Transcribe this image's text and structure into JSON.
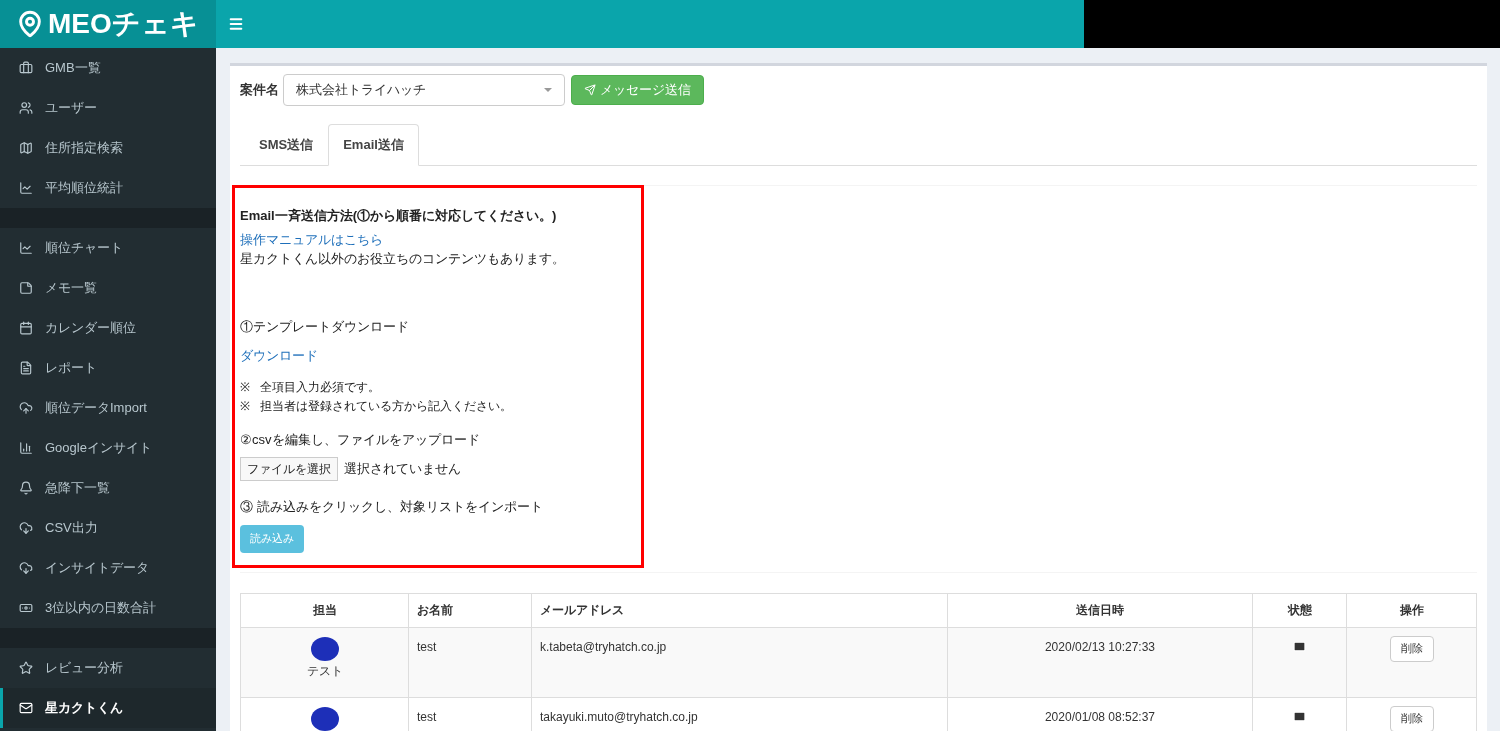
{
  "header": {
    "logo": "MEOチェキ"
  },
  "sidebar": {
    "groups": [
      {
        "items": [
          {
            "label": "GMB一覧",
            "selected": false
          },
          {
            "label": "ユーザー",
            "selected": false
          },
          {
            "label": "住所指定検索",
            "selected": false
          },
          {
            "label": "平均順位統計",
            "selected": false
          }
        ]
      },
      {
        "items": [
          {
            "label": "順位チャート",
            "selected": false
          },
          {
            "label": "メモ一覧",
            "selected": false
          },
          {
            "label": "カレンダー順位",
            "selected": false
          },
          {
            "label": "レポート",
            "selected": false
          },
          {
            "label": "順位データImport",
            "selected": false
          },
          {
            "label": "Googleインサイト",
            "selected": false
          },
          {
            "label": "急降下一覧",
            "selected": false
          },
          {
            "label": "CSV出力",
            "selected": false
          },
          {
            "label": "インサイトデータ",
            "selected": false
          },
          {
            "label": "3位以内の日数合計",
            "selected": false
          }
        ]
      },
      {
        "items": [
          {
            "label": "レビュー分析",
            "selected": false
          },
          {
            "label": "星カクトくん",
            "selected": true
          }
        ]
      }
    ]
  },
  "form": {
    "label": "案件名",
    "select_value": "株式会社トライハッチ",
    "send_button": "メッセージ送信"
  },
  "tabs": [
    {
      "label": "SMS送信",
      "selected": false
    },
    {
      "label": "Email送信",
      "selected": true
    }
  ],
  "instructions": {
    "title": "Email一斉送信方法(①から順番に対応してください。)",
    "manual_link": "操作マニュアルはこちら",
    "note": "星カクトくん以外のお役立ちのコンテンツもあります。",
    "step1": "①テンプレートダウンロード",
    "download_link": "ダウンロード",
    "remarks": [
      {
        "mark": "※",
        "text": "全項目入力必須です。"
      },
      {
        "mark": "※",
        "text": "担当者は登録されている方から記入ください。"
      }
    ],
    "step2": "②csvを編集し、ファイルをアップロード",
    "file_button": "ファイルを選択",
    "file_status": "選択されていません",
    "step3": "③ 読み込みをクリックし、対象リストをインポート",
    "load_button": "読み込み"
  },
  "table": {
    "columns": [
      "担当",
      "お名前",
      "メールアドレス",
      "送信日時",
      "状態",
      "操作"
    ],
    "rows": [
      {
        "person": "テスト",
        "name": "test",
        "email": "k.tabeta@tryhatch.co.jp",
        "sent_at": "2020/02/13 10:27:33",
        "action": "削除"
      },
      {
        "name": "test",
        "email": "takayuki.muto@tryhatch.co.jp",
        "sent_at": "2020/01/08 08:52:37",
        "action": "削除"
      }
    ]
  }
}
